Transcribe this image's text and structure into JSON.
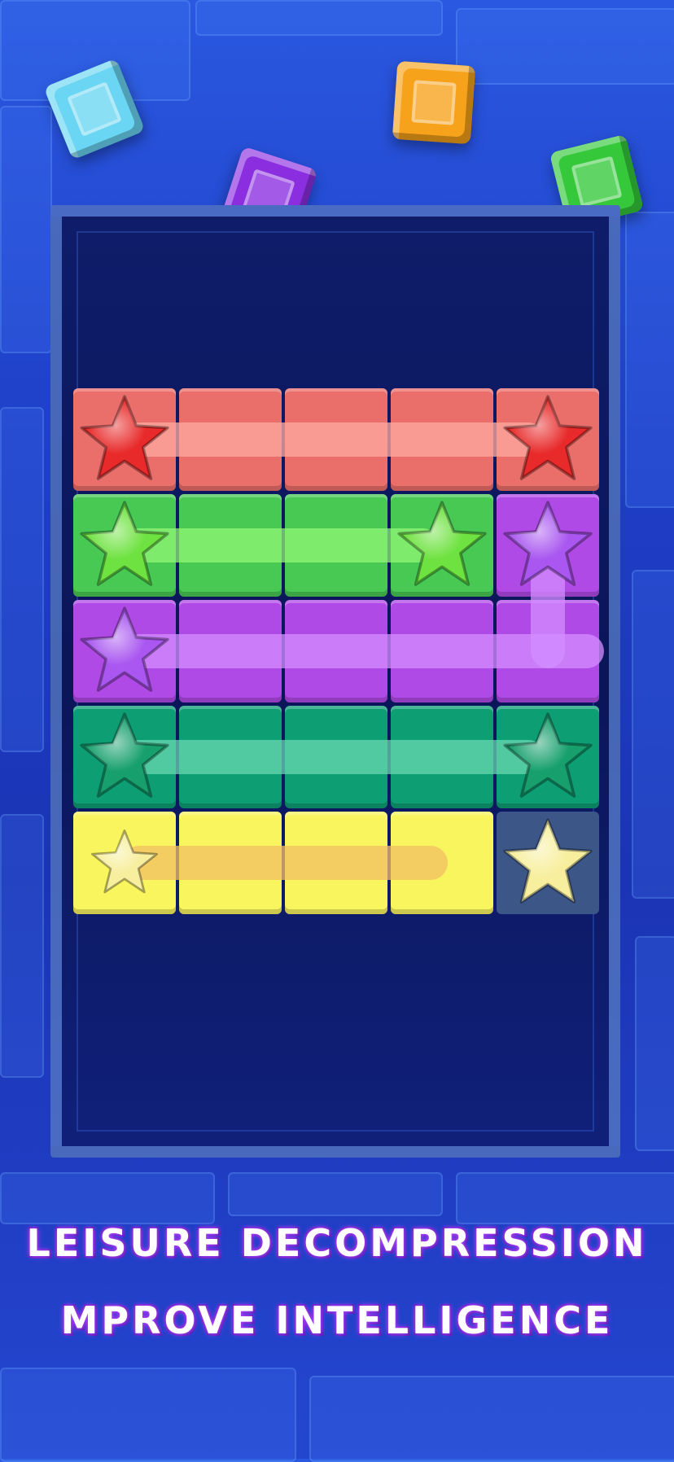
{
  "caption": {
    "line1": "LEISURE DECOMPRESSION",
    "line2": "MPROVE INTELLIGENCE"
  },
  "colors": {
    "red_row": "#ea6e6a",
    "green_row": "#48c954",
    "purple_row": "#b04ae6",
    "teal_row": "#0e9e74",
    "yellow_row": "#f9f55e",
    "empty_cell": "#3c5688",
    "red_star": "#e82a2a",
    "green_star": "#6ee240",
    "purple_star": "#a957f0",
    "teal_star": "#17a06e",
    "yellow_star": "#f7ef9e"
  },
  "grid": {
    "rows": 5,
    "cols": 5,
    "cells": [
      [
        "red",
        "red",
        "red",
        "red",
        "red"
      ],
      [
        "green",
        "green",
        "green",
        "green",
        "purple"
      ],
      [
        "purple",
        "purple",
        "purple",
        "purple",
        "purple"
      ],
      [
        "teal",
        "teal",
        "teal",
        "teal",
        "teal"
      ],
      [
        "yellow",
        "yellow",
        "yellow",
        "yellow",
        "empty"
      ]
    ],
    "stars": [
      {
        "color": "red",
        "row": 0,
        "col": 0
      },
      {
        "color": "red",
        "row": 0,
        "col": 4
      },
      {
        "color": "green",
        "row": 1,
        "col": 0
      },
      {
        "color": "green",
        "row": 1,
        "col": 3
      },
      {
        "color": "purple",
        "row": 1,
        "col": 4
      },
      {
        "color": "purple",
        "row": 2,
        "col": 0
      },
      {
        "color": "teal",
        "row": 3,
        "col": 0
      },
      {
        "color": "teal",
        "row": 3,
        "col": 4
      },
      {
        "color": "yellow",
        "row": 4,
        "col": 0
      },
      {
        "color": "yellow",
        "row": 4,
        "col": 4
      }
    ]
  },
  "decor": {
    "cubes": [
      "cyan-cube-icon",
      "orange-cube-icon",
      "purple-cube-icon",
      "green-cube-icon"
    ]
  }
}
